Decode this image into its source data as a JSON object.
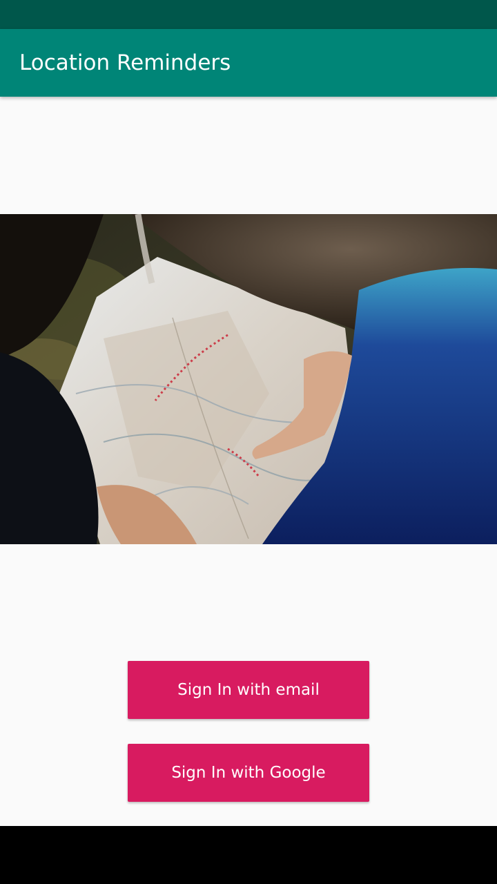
{
  "app_bar": {
    "title": "Location Reminders",
    "color": "#008577"
  },
  "status_bar": {
    "color": "#00574b"
  },
  "hero_image": {
    "description_icon": "map-photo"
  },
  "buttons": {
    "email_label": "Sign In with email",
    "google_label": "Sign In with Google",
    "color": "#d81b60"
  }
}
